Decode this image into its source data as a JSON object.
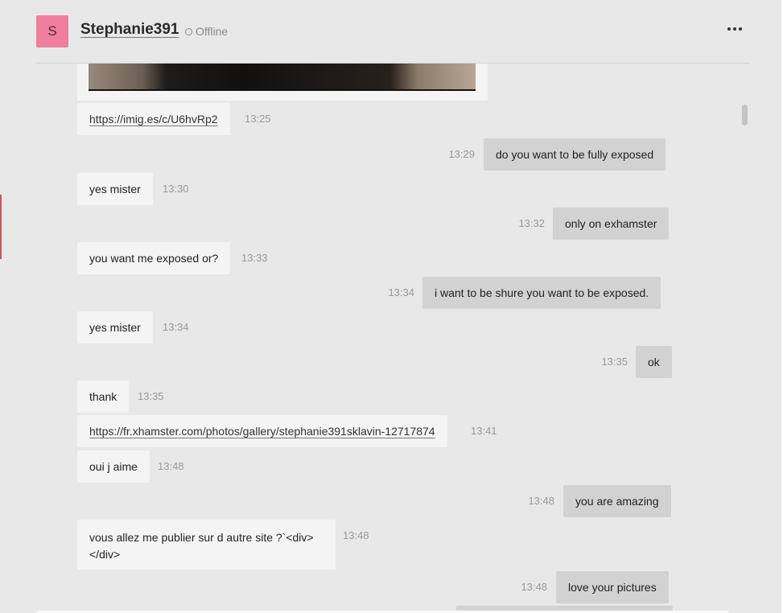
{
  "header": {
    "avatar_letter": "S",
    "username": "Stephanie391",
    "status": "Offline",
    "menu_icon": "more-horizontal-icon"
  },
  "messages": [
    {
      "id": "m1",
      "dir": "in",
      "text": "https://imig.es/c/U6hvRp2",
      "time": "13:25",
      "link": true
    },
    {
      "id": "m2",
      "dir": "out",
      "text": "do you want to be fully exposed",
      "time": "13:29"
    },
    {
      "id": "m3",
      "dir": "in",
      "text": "yes mister",
      "time": "13:30"
    },
    {
      "id": "m4",
      "dir": "out",
      "text": "only on exhamster",
      "time": "13:32"
    },
    {
      "id": "m5",
      "dir": "in",
      "text": "you want me exposed or?",
      "time": "13:33"
    },
    {
      "id": "m6",
      "dir": "out",
      "text": "i want to be shure you want to be exposed.",
      "time": "13:34"
    },
    {
      "id": "m7",
      "dir": "in",
      "text": "yes mister",
      "time": "13:34"
    },
    {
      "id": "m8",
      "dir": "out",
      "text": "ok",
      "time": "13:35"
    },
    {
      "id": "m9",
      "dir": "in",
      "text": "thank",
      "time": "13:35"
    },
    {
      "id": "m10",
      "dir": "in",
      "text": "https://fr.xhamster.com/photos/gallery/stephanie391sklavin-12717874",
      "time": "13:41",
      "link": true
    },
    {
      "id": "m11",
      "dir": "in",
      "text": "oui j aime",
      "time": "13:48"
    },
    {
      "id": "m12",
      "dir": "out",
      "text": "you are amazing",
      "time": "13:48"
    },
    {
      "id": "m13",
      "dir": "in",
      "text": "vous allez me publier sur d autre site ?`<div></div>",
      "time": "13:48"
    },
    {
      "id": "m14",
      "dir": "out",
      "text": "love your pictures",
      "time": "13:48"
    }
  ]
}
